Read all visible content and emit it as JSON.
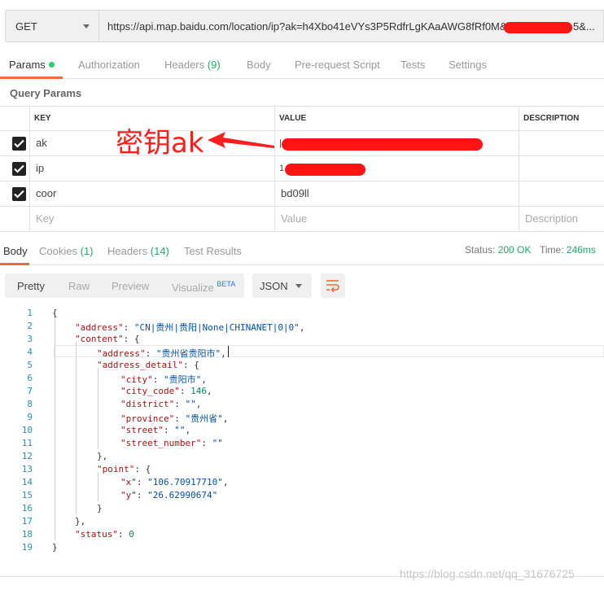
{
  "request": {
    "method": "GET",
    "url_visible": "https://api.map.baidu.com/location/ip?ak=h4Xbo41eVYs3P5RdfrLgKAaAWG8fRf0M&ip=",
    "url_tail": "5&..."
  },
  "request_tabs": [
    {
      "label": "Params",
      "count": "",
      "active": true
    },
    {
      "label": "Authorization",
      "count": "",
      "active": false
    },
    {
      "label": "Headers",
      "count": "(9)",
      "active": false
    },
    {
      "label": "Body",
      "count": "",
      "active": false
    },
    {
      "label": "Pre-request Script",
      "count": "",
      "active": false
    },
    {
      "label": "Tests",
      "count": "",
      "active": false
    },
    {
      "label": "Settings",
      "count": "",
      "active": false
    }
  ],
  "query_params": {
    "title": "Query Params",
    "columns": {
      "key": "KEY",
      "value": "VALUE",
      "description": "DESCRIPTION"
    },
    "rows": [
      {
        "key": "ak",
        "value": "",
        "checked": true
      },
      {
        "key": "ip",
        "value": "",
        "checked": true
      },
      {
        "key": "coor",
        "value": "bd09ll",
        "checked": true
      }
    ],
    "placeholders": {
      "key": "Key",
      "value": "Value",
      "description": "Description"
    }
  },
  "annotation": {
    "text": "密钥ak",
    "color": "#ff1e1e"
  },
  "response_tabs": [
    {
      "label": "Body",
      "count": "",
      "active": true
    },
    {
      "label": "Cookies",
      "count": "(1)",
      "active": false
    },
    {
      "label": "Headers",
      "count": "(14)",
      "active": false
    },
    {
      "label": "Test Results",
      "count": "",
      "active": false
    }
  ],
  "status": {
    "status_label": "Status:",
    "status_value": "200 OK",
    "time_label": "Time:",
    "time_value": "246ms"
  },
  "format_toolbar": {
    "buttons": [
      "Pretty",
      "Raw",
      "Preview",
      "Visualize"
    ],
    "beta": "BETA",
    "format_select": "JSON"
  },
  "code_lines": [
    {
      "n": "1"
    },
    {
      "n": "2"
    },
    {
      "n": "3"
    },
    {
      "n": "4"
    },
    {
      "n": "5"
    },
    {
      "n": "6"
    },
    {
      "n": "7"
    },
    {
      "n": "8"
    },
    {
      "n": "9"
    },
    {
      "n": "10"
    },
    {
      "n": "11"
    },
    {
      "n": "12"
    },
    {
      "n": "13"
    },
    {
      "n": "14"
    },
    {
      "n": "15"
    },
    {
      "n": "16"
    },
    {
      "n": "17"
    },
    {
      "n": "18"
    },
    {
      "n": "19"
    }
  ],
  "response_json": {
    "address": "CN|贵州|贵阳|None|CHINANET|0|0",
    "address_full": "贵州省贵阳市",
    "city": "贵阳市",
    "city_code": "146",
    "district": "",
    "province": "贵州省",
    "street": "",
    "street_number": "",
    "x": "106.70917710",
    "y": "26.62990674",
    "status": "0"
  },
  "watermark": "https://blog.csdn.net/qq_31676725",
  "colors": {
    "accent": "#f26b3a",
    "ok_green": "#2aa66b",
    "redaction": "#ff1414"
  }
}
